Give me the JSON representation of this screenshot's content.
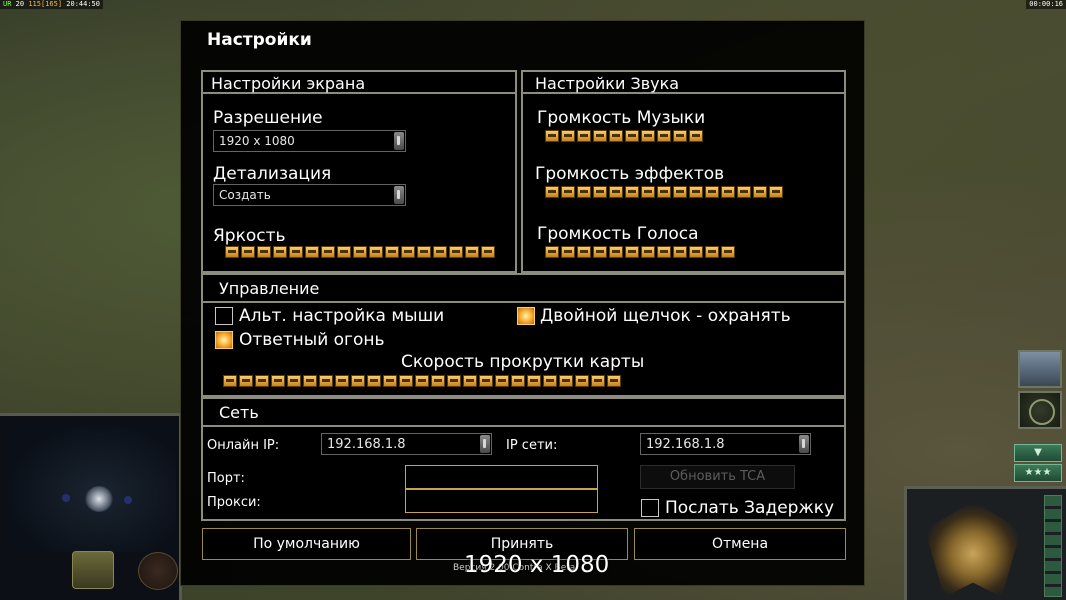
{
  "hud": {
    "perf_prefix": "UR",
    "perf_a": "20",
    "perf_b": "115",
    "perf_c": "[165]",
    "clock": "20:44:50",
    "game_timer": "00:00:16"
  },
  "window": {
    "title": "Настройки"
  },
  "screen": {
    "title": "Настройки экрана",
    "resolution_label": "Разрешение",
    "resolution_value": "1920 x 1080",
    "detail_label": "Детализация",
    "detail_value": "Создать",
    "brightness_label": "Яркость",
    "brightness_segments": 17
  },
  "sound": {
    "title": "Настройки Звука",
    "music_label": "Громкость Музыки",
    "music_segments": 10,
    "effects_label": "Громкость эффектов",
    "effects_segments": 15,
    "voice_label": "Громкость Голоса",
    "voice_segments": 12
  },
  "controls": {
    "title": "Управление",
    "alt_mouse_label": "Альт. настройка мыши",
    "alt_mouse_checked": false,
    "double_click_label": "Двойной щелчок - охранять",
    "double_click_checked": true,
    "return_fire_label": "Ответный огонь",
    "return_fire_checked": true,
    "scroll_speed_label": "Скорость прокрутки карты",
    "scroll_speed_segments": 25
  },
  "network": {
    "title": "Сеть",
    "online_ip_label": "Онлайн IP:",
    "online_ip_value": "192.168.1.8",
    "lan_ip_label": "IP сети:",
    "lan_ip_value": "192.168.1.8",
    "port_label": "Порт:",
    "port_value": "",
    "proxy_label": "Прокси:",
    "proxy_value": "",
    "update_tca_label": "Обновить TCA",
    "send_delay_label": "Послать Задержку",
    "send_delay_checked": false
  },
  "buttons": {
    "defaults": "По умолчанию",
    "accept": "Принять",
    "cancel": "Отмена"
  },
  "overlay": {
    "caption": "1920 x 1080",
    "version": "Версия 2.00 Contra X Beta"
  },
  "colors": {
    "slider_fill": "#ffb43a",
    "panel_border": "#8d8d7e",
    "button_border": "#9b8b46"
  }
}
